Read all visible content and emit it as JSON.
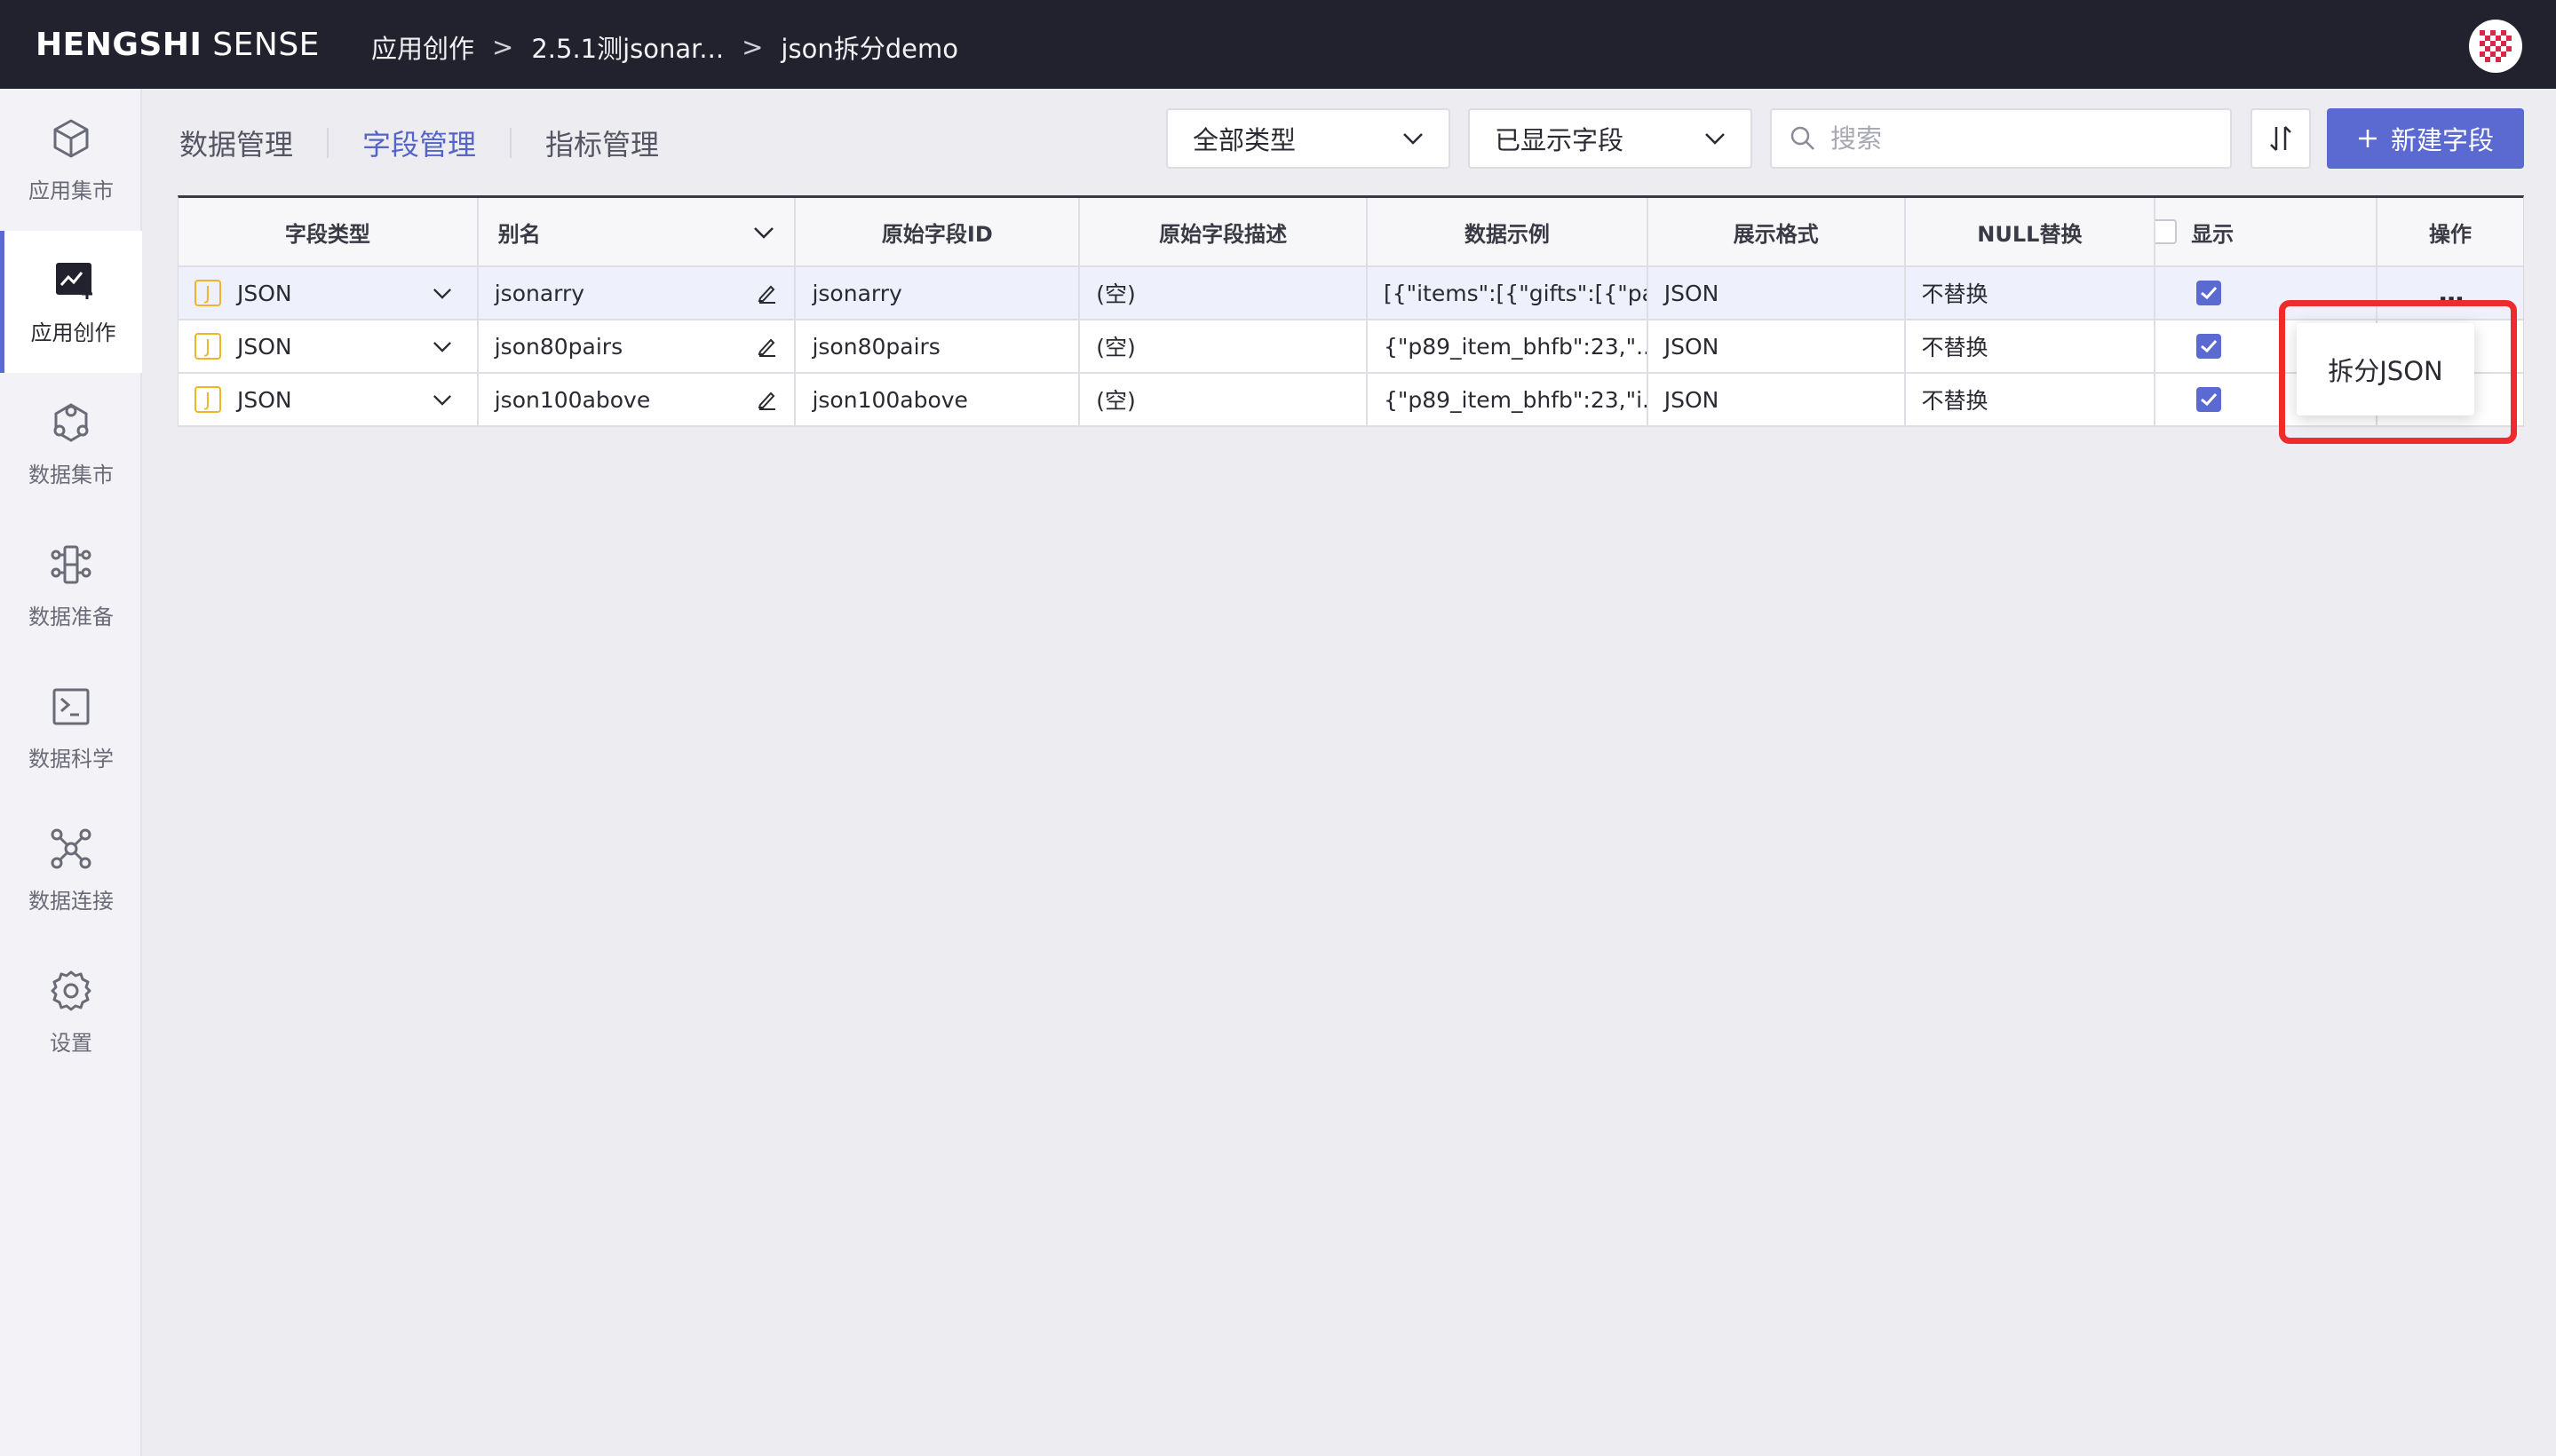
{
  "brand": {
    "bold": "HENGSHI",
    "light": " SENSE"
  },
  "breadcrumb": [
    "应用创作",
    "2.5.1测jsonar...",
    "json拆分demo"
  ],
  "breadcrumb_sep": ">",
  "sidebar": {
    "items": [
      {
        "label": "应用集市",
        "icon": "cube-icon",
        "active": false
      },
      {
        "label": "应用创作",
        "icon": "app-create-icon",
        "active": true
      },
      {
        "label": "数据集市",
        "icon": "hexagon-nodes-icon",
        "active": false
      },
      {
        "label": "数据准备",
        "icon": "data-prep-icon",
        "active": false
      },
      {
        "label": "数据科学",
        "icon": "terminal-icon",
        "active": false
      },
      {
        "label": "数据连接",
        "icon": "network-icon",
        "active": false
      },
      {
        "label": "设置",
        "icon": "gear-icon",
        "active": false
      }
    ]
  },
  "tabs": [
    {
      "label": "数据管理",
      "active": false
    },
    {
      "label": "字段管理",
      "active": true
    },
    {
      "label": "指标管理",
      "active": false
    }
  ],
  "filters": {
    "type_select": "全部类型",
    "display_select": "已显示字段",
    "search_placeholder": "搜索",
    "new_button": "新建字段"
  },
  "table": {
    "headers": [
      "字段类型",
      "别名",
      "原始字段ID",
      "原始字段描述",
      "数据示例",
      "展示格式",
      "NULL替换",
      "显示",
      "操作"
    ],
    "rows": [
      {
        "type_badge": "J",
        "type": "JSON",
        "alias": "jsonarry",
        "field_id": "jsonarry",
        "desc": "(空)",
        "sample": "[{\"items\":[{\"gifts\":[{\"pa...",
        "format": "JSON",
        "null_replace": "不替换",
        "shown": true
      },
      {
        "type_badge": "J",
        "type": "JSON",
        "alias": "json80pairs",
        "field_id": "json80pairs",
        "desc": "(空)",
        "sample": "{\"p89_item_bhfb\":23,\"...",
        "format": "JSON",
        "null_replace": "不替换",
        "shown": true
      },
      {
        "type_badge": "J",
        "type": "JSON",
        "alias": "json100above",
        "field_id": "json100above",
        "desc": "(空)",
        "sample": "{\"p89_item_bhfb\":23,\"i...",
        "format": "JSON",
        "null_replace": "不替换",
        "shown": true
      }
    ],
    "actions_label": "..."
  },
  "menu": {
    "split_json": "拆分JSON"
  },
  "colors": {
    "accent": "#5b6ad0",
    "topbar": "#22222e",
    "callout": "#ef2b2b",
    "json_badge": "#f0b429"
  }
}
